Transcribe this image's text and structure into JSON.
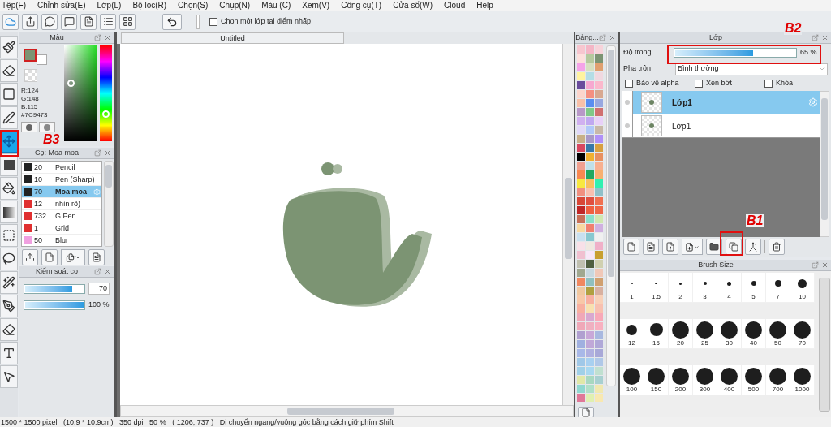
{
  "menu": [
    "Tệp(F)",
    "Chỉnh sửa(E)",
    "Lớp(L)",
    "Bộ lọc(R)",
    "Chọn(S)",
    "Chụp(N)",
    "Màu (C)",
    "Xem(V)",
    "Công cụ(T)",
    "Cửa sổ(W)",
    "Cloud",
    "Help"
  ],
  "toolbar": {
    "checkbox": {
      "label": "Chọn một lớp tại điểm nhấp",
      "checked": false
    }
  },
  "tools": [
    {
      "kind": "brush",
      "selected": false
    },
    {
      "kind": "eraser",
      "selected": false
    },
    {
      "kind": "shape",
      "selected": false
    },
    {
      "kind": "pen",
      "selected": false
    },
    {
      "kind": "move",
      "selected": true
    },
    {
      "kind": "fill",
      "selected": false
    },
    {
      "kind": "bucket",
      "selected": false
    },
    {
      "kind": "gradient",
      "selected": false
    },
    {
      "kind": "select",
      "selected": false
    },
    {
      "kind": "lasso",
      "selected": false
    },
    {
      "kind": "wand",
      "selected": false
    },
    {
      "kind": "select-pen",
      "selected": false
    },
    {
      "kind": "select-eraser",
      "selected": false
    },
    {
      "kind": "text",
      "selected": false
    },
    {
      "kind": "operation",
      "selected": false
    }
  ],
  "color_panel": {
    "title": "Màu",
    "color": "#7c9473",
    "r": "R:124",
    "g": "G:148",
    "b": "B:115",
    "hex": "#7C9473"
  },
  "brush_panel": {
    "title": "Cọ: Moa moa",
    "brushes": [
      {
        "size": "20",
        "name": "Pencil",
        "color": "#222222",
        "selected": false
      },
      {
        "size": "10",
        "name": "Pen (Sharp)",
        "color": "#222222",
        "selected": false
      },
      {
        "size": "70",
        "name": "Moa moa",
        "color": "#222222",
        "selected": true
      },
      {
        "size": "12",
        "name": "nhìn rõ)",
        "color": "#e03030",
        "selected": false
      },
      {
        "size": "732",
        "name": "G Pen",
        "color": "#e03030",
        "selected": false
      },
      {
        "size": "1",
        "name": "Grid",
        "color": "#e03030",
        "selected": false
      },
      {
        "size": "50",
        "name": "Blur",
        "color": "#f0a0e0",
        "selected": false
      }
    ]
  },
  "brush_control": {
    "title": "Kiểm soát cọ",
    "sliders": [
      {
        "kind": "field",
        "level": 0.8,
        "value": "70"
      },
      {
        "kind": "text",
        "level": 1,
        "value": "100 %"
      }
    ]
  },
  "canvas": {
    "tab": "Untitled"
  },
  "palette": {
    "title": "Bảng...",
    "swatches": [
      {
        "color": "#f7c6cf"
      },
      {
        "color": "#f4b6c6"
      },
      {
        "color": "#f7d3da"
      },
      {
        "color": "#fde0dc"
      },
      {
        "color": "#b5c99e"
      },
      {
        "color": "#7c9473"
      },
      {
        "color": "#f5a3e8"
      },
      {
        "color": "#d7dfc0"
      },
      {
        "color": "#e0a070"
      },
      {
        "color": "#fff3a0"
      },
      {
        "color": "#b4dde6"
      },
      {
        "color": "#f0d8e0"
      },
      {
        "color": "#6a4c9c"
      },
      {
        "color": "#f7a8d0"
      },
      {
        "color": "#fbb8cc"
      },
      {
        "color": "#fcd5cc"
      },
      {
        "color": "#f59080"
      },
      {
        "color": "#d8a890"
      },
      {
        "color": "#f8c0a8"
      },
      {
        "color": "#5a8ef0"
      },
      {
        "color": "#98a8e0"
      },
      {
        "color": "#b898c8"
      },
      {
        "color": "#80c888"
      },
      {
        "color": "#d07070"
      },
      {
        "color": "#d0b0f0"
      },
      {
        "color": "#c0a8f0"
      },
      {
        "color": "#e8d0f8"
      },
      {
        "color": "#e0d8f8"
      },
      {
        "color": "#b0c8f8"
      },
      {
        "color": "#c8b8a8"
      },
      {
        "color": "#c8b088"
      },
      {
        "color": "#a898c8"
      },
      {
        "color": "#b090f8"
      },
      {
        "color": "#d84860"
      },
      {
        "color": "#3878a8"
      },
      {
        "color": "#d8a040"
      },
      {
        "color": "#000000"
      },
      {
        "color": "#f0b030"
      },
      {
        "color": "#e89060"
      },
      {
        "color": "#f0a090"
      },
      {
        "color": "#c0e0e8"
      },
      {
        "color": "#f8b090"
      },
      {
        "color": "#f88850"
      },
      {
        "color": "#20a860"
      },
      {
        "color": "#f8b070"
      },
      {
        "color": "#f8e840"
      },
      {
        "color": "#f8c060"
      },
      {
        "color": "#30f0b0"
      },
      {
        "color": "#f09080"
      },
      {
        "color": "#f8c0b0"
      },
      {
        "color": "#90c0c8"
      },
      {
        "color": "#d84838"
      },
      {
        "color": "#e05040"
      },
      {
        "color": "#f07050"
      },
      {
        "color": "#c02828"
      },
      {
        "color": "#f06040"
      },
      {
        "color": "#f06848"
      },
      {
        "color": "#c87058"
      },
      {
        "color": "#88e0c8"
      },
      {
        "color": "#d0e8b0"
      },
      {
        "color": "#f8d8a0"
      },
      {
        "color": "#f08070"
      },
      {
        "color": "#d0b0e0"
      },
      {
        "color": "#c8e0f0"
      },
      {
        "color": "#88c8d0"
      },
      {
        "color": "#f0f0f0"
      },
      {
        "color": "#f8e0e8"
      },
      {
        "color": "#f0e8e0"
      },
      {
        "color": "#f0b0c8"
      },
      {
        "color": "#f0c0d0"
      },
      {
        "color": "#f8e8f8"
      },
      {
        "color": "#c8a030"
      },
      {
        "color": "#c0c0b0"
      },
      {
        "color": "#506040"
      },
      {
        "color": "#d0d0b0"
      },
      {
        "color": "#a0a890"
      },
      {
        "color": "#c8d8e0"
      },
      {
        "color": "#f0c8b8"
      },
      {
        "color": "#f08860"
      },
      {
        "color": "#90c0c0"
      },
      {
        "color": "#d0a070"
      },
      {
        "color": "#f0c8a0"
      },
      {
        "color": "#b0a040"
      },
      {
        "color": "#d8b0a0"
      },
      {
        "color": "#f8c8a8"
      },
      {
        "color": "#f8b0a0"
      },
      {
        "color": "#f8d0b8"
      },
      {
        "color": "#f8b0a0"
      },
      {
        "color": "#f8e0b0"
      },
      {
        "color": "#f8c0b0"
      },
      {
        "color": "#f0a8b8"
      },
      {
        "color": "#d8a8d0"
      },
      {
        "color": "#f8a8b8"
      },
      {
        "color": "#f0a8b8"
      },
      {
        "color": "#f0b0c0"
      },
      {
        "color": "#f8b0c0"
      },
      {
        "color": "#b0a0d0"
      },
      {
        "color": "#c8a8d8"
      },
      {
        "color": "#a8b8e0"
      },
      {
        "color": "#a0b0e0"
      },
      {
        "color": "#c0a8d8"
      },
      {
        "color": "#b0a8d8"
      },
      {
        "color": "#a8b8e8"
      },
      {
        "color": "#b0b0e0"
      },
      {
        "color": "#a8a8d8"
      },
      {
        "color": "#a0c8e8"
      },
      {
        "color": "#a8d0f0"
      },
      {
        "color": "#b0c8e8"
      },
      {
        "color": "#a0d0e8"
      },
      {
        "color": "#a8d8f0"
      },
      {
        "color": "#c0e0d0"
      },
      {
        "color": "#e0e8a8"
      },
      {
        "color": "#a8d8c0"
      },
      {
        "color": "#a8d0d0"
      },
      {
        "color": "#90d8d0"
      },
      {
        "color": "#b0e0c8"
      },
      {
        "color": "#f0e8b0"
      },
      {
        "color": "#e07898"
      },
      {
        "color": "#e0f0b0"
      },
      {
        "color": "#f8e8b0"
      }
    ]
  },
  "layer_panel": {
    "title": "Lớp",
    "opacity": {
      "label": "Độ trong",
      "level": 0.65,
      "value": "65 %"
    },
    "blend": {
      "label": "Pha trộn",
      "value": "Bình thường"
    },
    "options": [
      {
        "label": "Bảo vệ alpha",
        "checked": false
      },
      {
        "label": "Xén bớt",
        "checked": false
      },
      {
        "label": "Khóa",
        "checked": false
      }
    ],
    "layers": [
      {
        "name": "Lớp1",
        "selected": true
      },
      {
        "name": "Lớp1",
        "selected": false
      }
    ]
  },
  "brush_size": {
    "title": "Brush Size",
    "sizes": [
      "1",
      "1.5",
      "2",
      "3",
      "4",
      "5",
      "7",
      "10",
      "12",
      "15",
      "20",
      "25",
      "30",
      "40",
      "50",
      "70",
      "100",
      "150",
      "200",
      "300",
      "400",
      "500",
      "700",
      "1000"
    ]
  },
  "status_bar": "1500 * 1500 pixel   (10.9 * 10.9cm)   350 dpi   50 %   ( 1206, 737 )   Di chuyển ngang/vuông góc bằng cách giữ phím Shift",
  "annotations": [
    "B2",
    "B3",
    "B1"
  ]
}
